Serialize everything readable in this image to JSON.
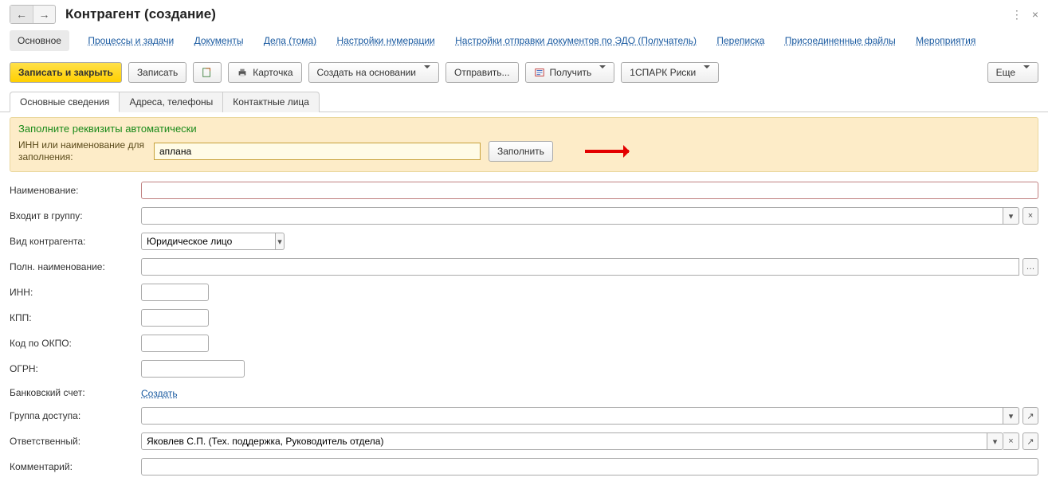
{
  "header": {
    "title": "Контрагент (создание)"
  },
  "navlinks": {
    "items": [
      "Основное",
      "Процессы и задачи",
      "Документы",
      "Дела (тома)",
      "Настройки нумерации",
      "Настройки отправки документов по ЭДО (Получатель)",
      "Переписка",
      "Присоединенные файлы",
      "Мероприятия"
    ],
    "active_index": 0
  },
  "toolbar": {
    "save_close": "Записать и закрыть",
    "save": "Записать",
    "card": "Карточка",
    "create_from": "Создать на основании",
    "send": "Отправить...",
    "receive": "Получить",
    "spark": "1СПАРК Риски",
    "more": "Еще"
  },
  "tabs": {
    "items": [
      "Основные сведения",
      "Адреса, телефоны",
      "Контактные лица"
    ],
    "active_index": 0
  },
  "autopanel": {
    "title": "Заполните реквизиты автоматически",
    "label": "ИНН или наименование для заполнения:",
    "value": "аплана",
    "fill_btn": "Заполнить"
  },
  "form": {
    "name_label": "Наименование:",
    "name_value": "",
    "group_label": "Входит в группу:",
    "group_value": "",
    "type_label": "Вид контрагента:",
    "type_value": "Юридическое лицо",
    "fullname_label": "Полн. наименование:",
    "fullname_value": "",
    "inn_label": "ИНН:",
    "inn_value": "",
    "kpp_label": "КПП:",
    "kpp_value": "",
    "okpo_label": "Код по ОКПО:",
    "okpo_value": "",
    "ogrn_label": "ОГРН:",
    "ogrn_value": "",
    "bank_label": "Банковский счет:",
    "bank_create": "Создать",
    "accessgrp_label": "Группа доступа:",
    "accessgrp_value": "",
    "responsible_label": "Ответственный:",
    "responsible_value": "Яковлев С.П. (Тех. поддержка, Руководитель отдела)",
    "comment_label": "Комментарий:",
    "comment_value": ""
  }
}
